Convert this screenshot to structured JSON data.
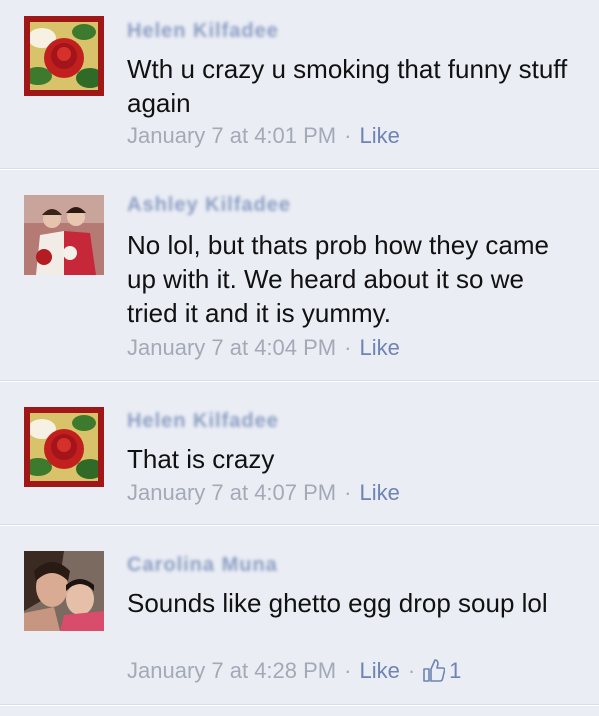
{
  "comments": [
    {
      "name": "Helen Kilfadee",
      "text": "Wth u crazy u smoking that funny stuff again",
      "timestamp": "January 7 at 4:01 PM",
      "like_label": "Like",
      "avatar": "rose-avatar"
    },
    {
      "name": "Ashley Kilfadee",
      "text": "No lol, but thats prob how they came up with it. We heard about it so we tried it and it is yummy.",
      "timestamp": "January 7 at 4:04 PM",
      "like_label": "Like",
      "avatar": "couple-avatar"
    },
    {
      "name": "Helen Kilfadee",
      "text": "That is crazy",
      "timestamp": "January 7 at 4:07 PM",
      "like_label": "Like",
      "avatar": "rose-avatar"
    },
    {
      "name": "Carolina Muna",
      "text": "Sounds like ghetto egg drop soup lol",
      "timestamp": "January 7 at 4:28 PM",
      "like_label": "Like",
      "like_count": "1",
      "avatar": "selfie-avatar"
    }
  ],
  "separator": "·",
  "colors": {
    "background": "#eaedf4",
    "link": "#6d84b4",
    "meta": "#a3a9b6",
    "text": "#111111"
  }
}
